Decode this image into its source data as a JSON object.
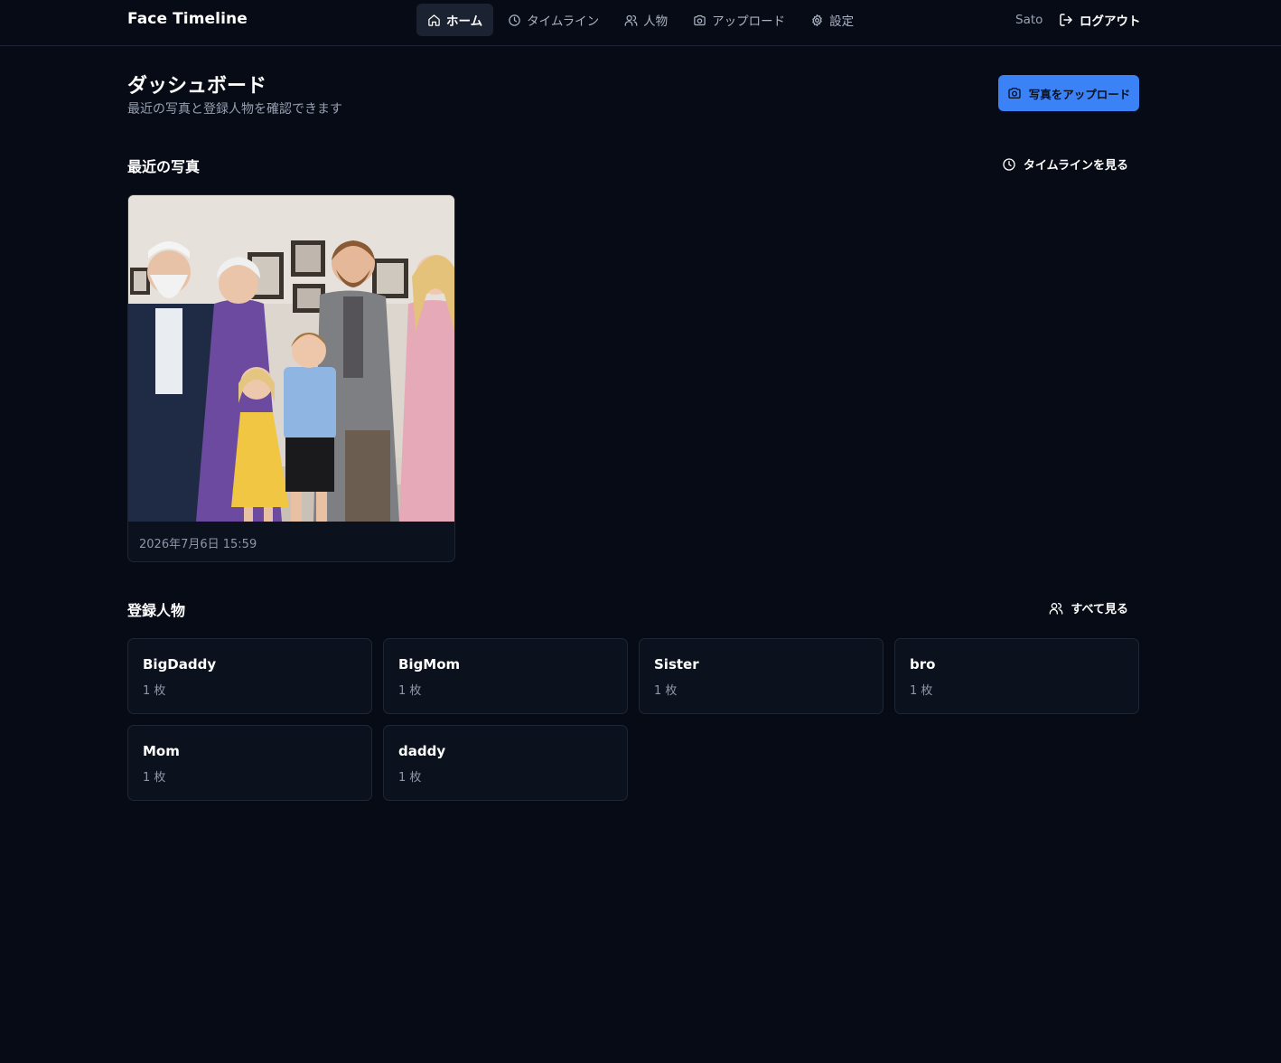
{
  "header": {
    "brand": "Face Timeline",
    "nav": [
      {
        "label": "ホーム",
        "icon": "home-icon",
        "active": true
      },
      {
        "label": "タイムライン",
        "icon": "clock-icon",
        "active": false
      },
      {
        "label": "人物",
        "icon": "users-icon",
        "active": false
      },
      {
        "label": "アップロード",
        "icon": "camera-icon",
        "active": false
      },
      {
        "label": "設定",
        "icon": "gear-icon",
        "active": false
      }
    ],
    "user": "Sato",
    "logout_label": "ログアウト"
  },
  "dashboard": {
    "title": "ダッシュボード",
    "subtitle": "最近の写真と登録人物を確認できます",
    "upload_label": "写真をアップロード"
  },
  "recent": {
    "title": "最近の写真",
    "link_label": "タイムラインを見る",
    "photos": [
      {
        "date": "2026年7月6日 15:59"
      }
    ]
  },
  "people": {
    "title": "登録人物",
    "link_label": "すべて見る",
    "items": [
      {
        "name": "BigDaddy",
        "count": "1 枚"
      },
      {
        "name": "BigMom",
        "count": "1 枚"
      },
      {
        "name": "Sister",
        "count": "1 枚"
      },
      {
        "name": "bro",
        "count": "1 枚"
      },
      {
        "name": "Mom",
        "count": "1 枚"
      },
      {
        "name": "daddy",
        "count": "1 枚"
      }
    ]
  },
  "colors": {
    "background": "#070b16",
    "card": "#0b111d",
    "border": "#1f2737",
    "accent": "#3b82f6",
    "muted": "#8e97a8"
  }
}
